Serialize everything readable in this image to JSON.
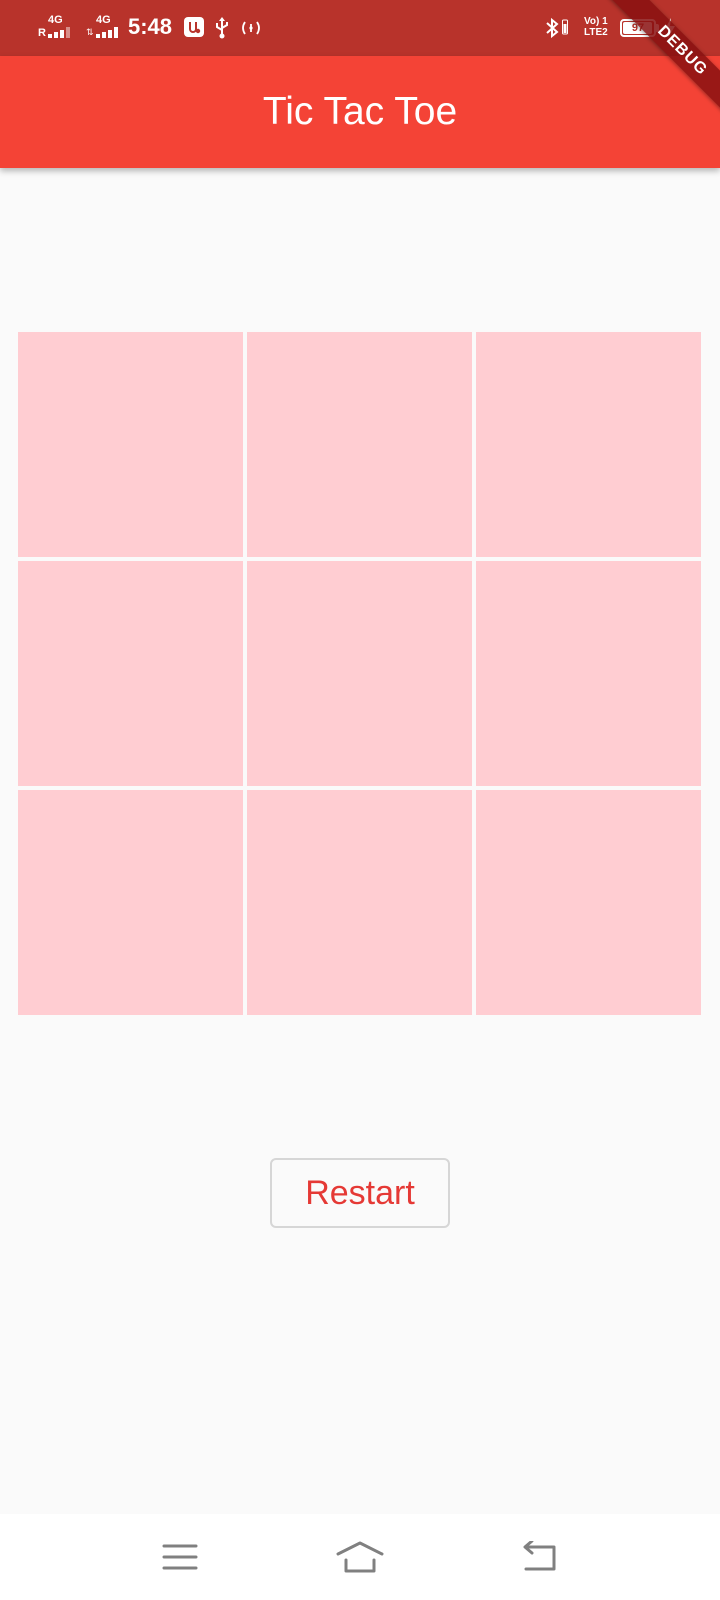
{
  "status_bar": {
    "sim1": {
      "generation": "4G",
      "roaming": "R"
    },
    "sim2": {
      "generation": "4G"
    },
    "time": "5:48",
    "volte": {
      "line1": "Vo) 1",
      "line2": "LTE2"
    },
    "battery": {
      "percent": "97",
      "level": 0.97,
      "charging": true
    },
    "icons": [
      "usb-debug-icon",
      "usb-icon",
      "hotspot-icon",
      "bluetooth-icon",
      "charging-bolt-icon"
    ]
  },
  "debug_banner": "DEBUG",
  "app_bar": {
    "title": "Tic Tac Toe"
  },
  "board": {
    "cells": [
      "",
      "",
      "",
      "",
      "",
      "",
      "",
      "",
      ""
    ]
  },
  "restart_label": "Restart",
  "colors": {
    "status_bar": "#b8332b",
    "app_bar": "#f44336",
    "cell": "#ffcdd2",
    "background": "#fafafa",
    "restart_text": "#e53935",
    "debug_banner": "#881010"
  },
  "nav_bar": {
    "icons": [
      "menu-icon",
      "home-icon",
      "back-icon"
    ]
  }
}
